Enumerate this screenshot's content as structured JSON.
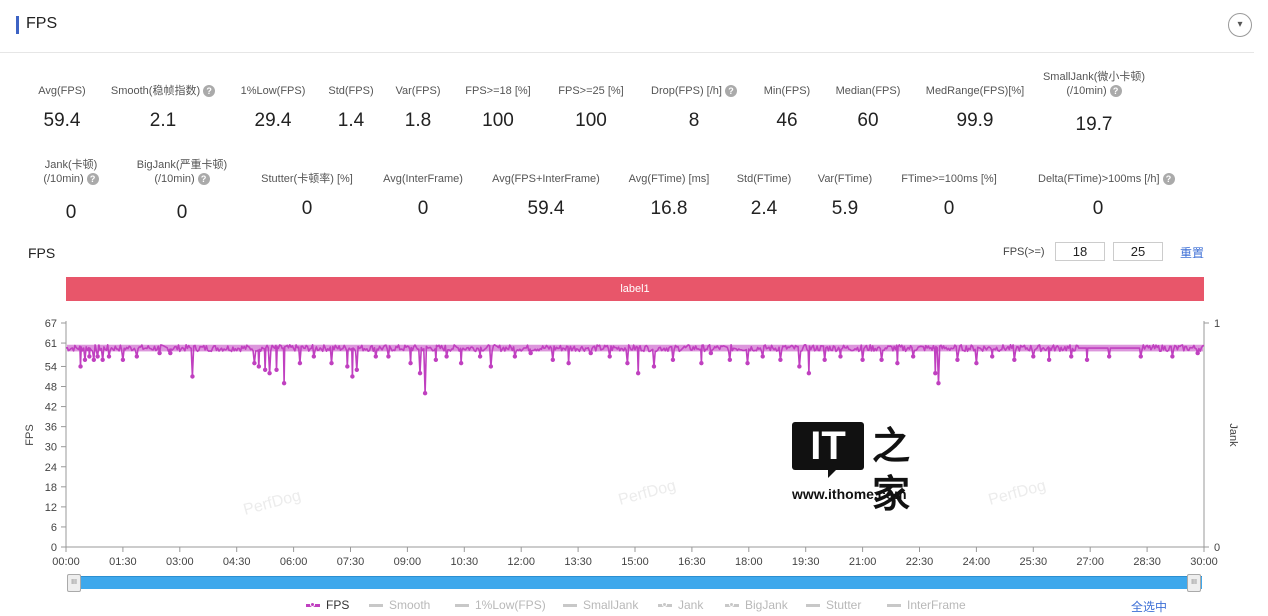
{
  "section": {
    "title": "FPS",
    "collapse_icon": "▾"
  },
  "stats_row1": [
    {
      "label": "Avg(FPS)",
      "value": "59.4",
      "help": false
    },
    {
      "label": "Smooth(稳帧指数)",
      "value": "2.1",
      "help": true
    },
    {
      "label": "1%Low(FPS)",
      "value": "29.4",
      "help": false
    },
    {
      "label": "Std(FPS)",
      "value": "1.4",
      "help": false
    },
    {
      "label": "Var(FPS)",
      "value": "1.8",
      "help": false
    },
    {
      "label": "FPS>=18 [%]",
      "value": "100",
      "help": false
    },
    {
      "label": "FPS>=25 [%]",
      "value": "100",
      "help": false
    },
    {
      "label": "Drop(FPS) [/h]",
      "value": "8",
      "help": true
    },
    {
      "label": "Min(FPS)",
      "value": "46",
      "help": false
    },
    {
      "label": "Median(FPS)",
      "value": "60",
      "help": false
    },
    {
      "label": "MedRange(FPS)[%]",
      "value": "99.9",
      "help": false
    },
    {
      "label": "SmallJank(微小卡顿)",
      "label2": "(/10min)",
      "value": "19.7",
      "help": true
    }
  ],
  "stats_row2": [
    {
      "label": "Jank(卡顿)",
      "label2": "(/10min)",
      "value": "0",
      "help": true
    },
    {
      "label": "BigJank(严重卡顿)",
      "label2": "(/10min)",
      "value": "0",
      "help": true
    },
    {
      "label": "Stutter(卡顿率) [%]",
      "value": "0",
      "help": false
    },
    {
      "label": "Avg(InterFrame)",
      "value": "0",
      "help": false
    },
    {
      "label": "Avg(FPS+InterFrame)",
      "value": "59.4",
      "help": false
    },
    {
      "label": "Avg(FTime) [ms]",
      "value": "16.8",
      "help": false
    },
    {
      "label": "Std(FTime)",
      "value": "2.4",
      "help": false
    },
    {
      "label": "Var(FTime)",
      "value": "5.9",
      "help": false
    },
    {
      "label": "FTime>=100ms [%]",
      "value": "0",
      "help": false
    },
    {
      "label": "Delta(FTime)>100ms [/h]",
      "value": "0",
      "help": true
    }
  ],
  "chart_header": {
    "title": "FPS",
    "threshold_label": "FPS(>=)",
    "threshold_1": "18",
    "threshold_2": "25",
    "reset_label": "重置"
  },
  "label_band": "label1",
  "watermark": "PerfDog",
  "ithome": {
    "logo_text": "IT",
    "logo_cn": "之家",
    "url": "www.ithome.com"
  },
  "legend": {
    "items": [
      {
        "name": "FPS",
        "active": true,
        "marker": "dot"
      },
      {
        "name": "Smooth",
        "active": false,
        "marker": "line"
      },
      {
        "name": "1%Low(FPS)",
        "active": false,
        "marker": "line"
      },
      {
        "name": "SmallJank",
        "active": false,
        "marker": "line"
      },
      {
        "name": "Jank",
        "active": false,
        "marker": "dot"
      },
      {
        "name": "BigJank",
        "active": false,
        "marker": "dot"
      },
      {
        "name": "Stutter",
        "active": false,
        "marker": "line"
      },
      {
        "name": "InterFrame",
        "active": false,
        "marker": "line"
      }
    ],
    "select_all": "全选中"
  },
  "slider": {
    "range_start_fraction": 0,
    "range_end_fraction": 1
  },
  "chart_data": {
    "type": "line",
    "title": "FPS",
    "xlabel": "",
    "ylabel": "FPS",
    "y2label": "Jank",
    "ylim": [
      0,
      67
    ],
    "y2lim": [
      0,
      1
    ],
    "yticks": [
      0,
      6,
      12,
      18,
      24,
      30,
      36,
      42,
      48,
      54,
      61,
      67
    ],
    "y2ticks": [
      0,
      1
    ],
    "xlim_seconds": [
      0,
      1800
    ],
    "xticks": [
      "00:00",
      "01:30",
      "03:00",
      "04:30",
      "06:00",
      "07:30",
      "09:00",
      "10:30",
      "12:00",
      "13:30",
      "15:00",
      "16:30",
      "18:00",
      "19:30",
      "21:00",
      "22:30",
      "24:00",
      "25:30",
      "27:00",
      "28:30",
      "30:00"
    ],
    "grid": false,
    "legend_position": "bottom",
    "series": [
      {
        "name": "FPS",
        "color": "#c040c0",
        "baseline": 59.5,
        "band": [
          58.5,
          60.5
        ],
        "dips": [
          {
            "t": 23,
            "v": 54
          },
          {
            "t": 30,
            "v": 56
          },
          {
            "t": 37,
            "v": 57
          },
          {
            "t": 44,
            "v": 56
          },
          {
            "t": 50,
            "v": 57
          },
          {
            "t": 58,
            "v": 56
          },
          {
            "t": 68,
            "v": 57
          },
          {
            "t": 90,
            "v": 56
          },
          {
            "t": 112,
            "v": 57
          },
          {
            "t": 148,
            "v": 58
          },
          {
            "t": 165,
            "v": 58
          },
          {
            "t": 200,
            "v": 51
          },
          {
            "t": 298,
            "v": 55
          },
          {
            "t": 305,
            "v": 54
          },
          {
            "t": 315,
            "v": 53
          },
          {
            "t": 322,
            "v": 52
          },
          {
            "t": 333,
            "v": 53
          },
          {
            "t": 345,
            "v": 49
          },
          {
            "t": 370,
            "v": 55
          },
          {
            "t": 392,
            "v": 57
          },
          {
            "t": 420,
            "v": 55
          },
          {
            "t": 445,
            "v": 54
          },
          {
            "t": 453,
            "v": 51
          },
          {
            "t": 460,
            "v": 53
          },
          {
            "t": 490,
            "v": 57
          },
          {
            "t": 510,
            "v": 57
          },
          {
            "t": 545,
            "v": 55
          },
          {
            "t": 560,
            "v": 52
          },
          {
            "t": 568,
            "v": 46
          },
          {
            "t": 585,
            "v": 56
          },
          {
            "t": 602,
            "v": 57
          },
          {
            "t": 625,
            "v": 55
          },
          {
            "t": 655,
            "v": 57
          },
          {
            "t": 672,
            "v": 54
          },
          {
            "t": 710,
            "v": 57
          },
          {
            "t": 735,
            "v": 58
          },
          {
            "t": 770,
            "v": 56
          },
          {
            "t": 795,
            "v": 55
          },
          {
            "t": 830,
            "v": 58
          },
          {
            "t": 860,
            "v": 57
          },
          {
            "t": 888,
            "v": 55
          },
          {
            "t": 905,
            "v": 52
          },
          {
            "t": 930,
            "v": 54
          },
          {
            "t": 960,
            "v": 56
          },
          {
            "t": 1005,
            "v": 55
          },
          {
            "t": 1020,
            "v": 58
          },
          {
            "t": 1050,
            "v": 56
          },
          {
            "t": 1078,
            "v": 55
          },
          {
            "t": 1102,
            "v": 57
          },
          {
            "t": 1130,
            "v": 56
          },
          {
            "t": 1160,
            "v": 54
          },
          {
            "t": 1175,
            "v": 52
          },
          {
            "t": 1200,
            "v": 56
          },
          {
            "t": 1225,
            "v": 57
          },
          {
            "t": 1260,
            "v": 56
          },
          {
            "t": 1290,
            "v": 56
          },
          {
            "t": 1315,
            "v": 55
          },
          {
            "t": 1340,
            "v": 57
          },
          {
            "t": 1375,
            "v": 52
          },
          {
            "t": 1380,
            "v": 49
          },
          {
            "t": 1410,
            "v": 56
          },
          {
            "t": 1440,
            "v": 55
          },
          {
            "t": 1465,
            "v": 57
          },
          {
            "t": 1500,
            "v": 56
          },
          {
            "t": 1530,
            "v": 57
          },
          {
            "t": 1555,
            "v": 56
          },
          {
            "t": 1590,
            "v": 57
          },
          {
            "t": 1615,
            "v": 56
          },
          {
            "t": 1650,
            "v": 57
          },
          {
            "t": 1700,
            "v": 57
          },
          {
            "t": 1750,
            "v": 57
          },
          {
            "t": 1790,
            "v": 58
          }
        ]
      }
    ]
  }
}
